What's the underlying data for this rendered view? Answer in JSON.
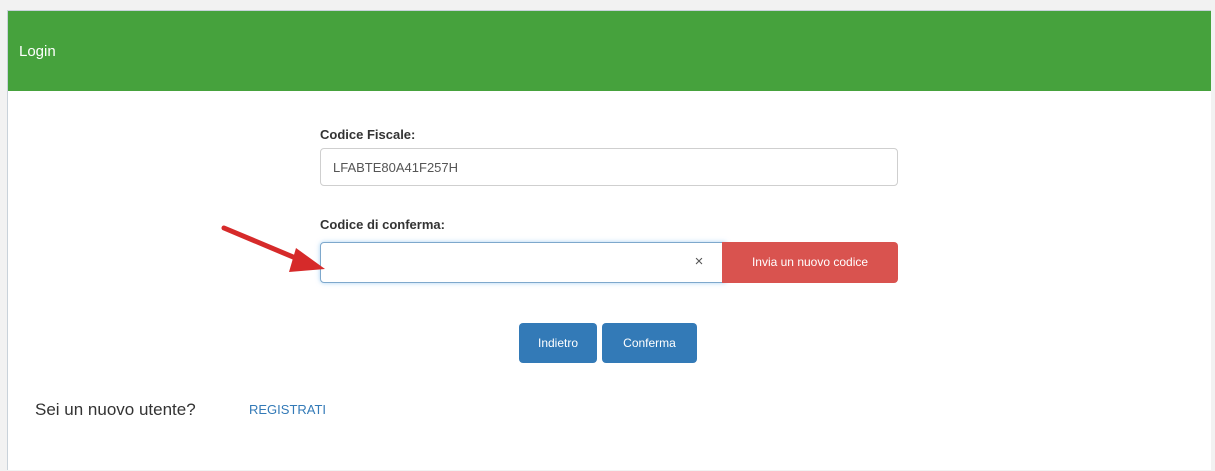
{
  "header": {
    "title": "Login"
  },
  "form": {
    "codice_fiscale_label": "Codice Fiscale:",
    "codice_fiscale_value": "LFABTE80A41F257H",
    "codice_conferma_label": "Codice di conferma:",
    "codice_conferma_value": "",
    "clear_symbol": "×",
    "new_code_button_label": "Invia un nuovo codice",
    "back_button_label": "Indietro",
    "confirm_button_label": "Conferma"
  },
  "footer": {
    "new_user_text": "Sei un nuovo utente?",
    "register_link_label": "REGISTRATI"
  },
  "colors": {
    "header_green": "#46a23d",
    "primary_blue": "#337ab7",
    "danger_red": "#d9534f",
    "annotation_arrow_red": "#d62a2a"
  },
  "icons": {
    "clear": "close-icon",
    "annotation": "red-arrow-annotation"
  }
}
